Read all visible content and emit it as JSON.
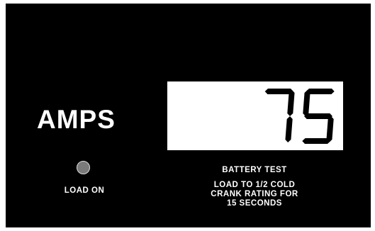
{
  "display": {
    "unit_label": "AMPS",
    "reading": "75"
  },
  "indicator": {
    "label": "LOAD ON",
    "color": "#7a7a7a"
  },
  "test": {
    "title": "BATTERY TEST",
    "instructions": [
      "LOAD TO 1/2 COLD",
      "CRANK RATING FOR",
      "15 SECONDS"
    ]
  },
  "colors": {
    "panel": "#000000",
    "text": "#ffffff",
    "lcd_background": "#ffffff",
    "lcd_segments": "#000000"
  }
}
